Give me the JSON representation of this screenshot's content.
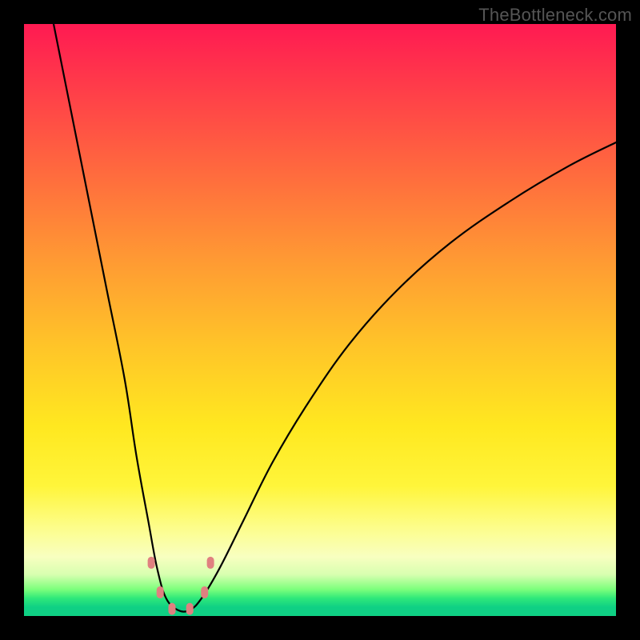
{
  "watermark": "TheBottleneck.com",
  "chart_data": {
    "type": "line",
    "title": "",
    "xlabel": "",
    "ylabel": "",
    "xlim": [
      0,
      100
    ],
    "ylim": [
      0,
      100
    ],
    "series": [
      {
        "name": "bottleneck-curve",
        "x": [
          5,
          8,
          11,
          14,
          17,
          19,
          21,
          22.5,
          24,
          26,
          28,
          30,
          33,
          37,
          42,
          48,
          55,
          63,
          72,
          82,
          92,
          100
        ],
        "values": [
          100,
          85,
          70,
          55,
          40,
          27,
          16,
          8,
          3,
          1,
          1,
          3,
          8,
          16,
          26,
          36,
          46,
          55,
          63,
          70,
          76,
          80
        ]
      }
    ],
    "markers": [
      {
        "x": 21.5,
        "y": 9
      },
      {
        "x": 23.0,
        "y": 4
      },
      {
        "x": 25.0,
        "y": 1.2
      },
      {
        "x": 28.0,
        "y": 1.2
      },
      {
        "x": 30.5,
        "y": 4
      },
      {
        "x": 31.5,
        "y": 9
      }
    ],
    "gradient_stops": [
      {
        "pct": 0,
        "color": "#ff1a52"
      },
      {
        "pct": 40,
        "color": "#ff9a33"
      },
      {
        "pct": 78,
        "color": "#fff53a"
      },
      {
        "pct": 97,
        "color": "#2fe87a"
      },
      {
        "pct": 100,
        "color": "#0fd084"
      }
    ]
  }
}
